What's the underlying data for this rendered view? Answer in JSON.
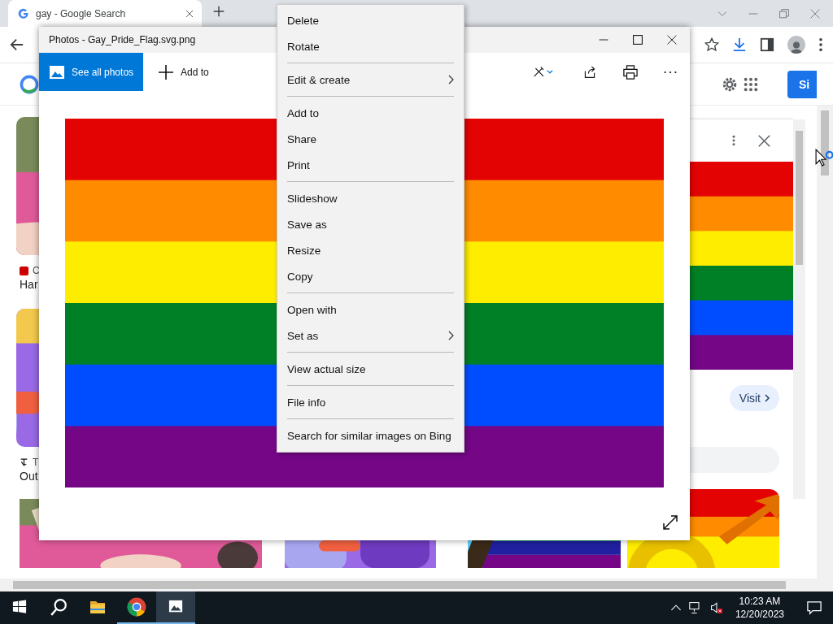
{
  "browser": {
    "tab": {
      "title": "gay - Google Search"
    },
    "page": {
      "sign_in": "Si",
      "results": [
        {
          "source": "C",
          "title": "Har",
          "kind": "cnn"
        },
        {
          "source": "T",
          "title": "Out",
          "kind": "nyt"
        }
      ],
      "side_panel": {
        "visit": "Visit"
      }
    }
  },
  "photos_window": {
    "title": "Photos - Gay_Pride_Flag.svg.png",
    "see_all": "See all photos",
    "add_to": "Add to"
  },
  "context_menu": {
    "groups": [
      [
        {
          "label": "Delete",
          "submenu": false
        },
        {
          "label": "Rotate",
          "submenu": false
        }
      ],
      [
        {
          "label": "Edit & create",
          "submenu": true
        }
      ],
      [
        {
          "label": "Add to",
          "submenu": false
        },
        {
          "label": "Share",
          "submenu": false
        },
        {
          "label": "Print",
          "submenu": false
        }
      ],
      [
        {
          "label": "Slideshow",
          "submenu": false
        },
        {
          "label": "Save as",
          "submenu": false
        },
        {
          "label": "Resize",
          "submenu": false
        },
        {
          "label": "Copy",
          "submenu": false
        }
      ],
      [
        {
          "label": "Open with",
          "submenu": false
        },
        {
          "label": "Set as",
          "submenu": true
        }
      ],
      [
        {
          "label": "View actual size",
          "submenu": false
        }
      ],
      [
        {
          "label": "File info",
          "submenu": false
        }
      ],
      [
        {
          "label": "Search for similar images on Bing",
          "submenu": false
        }
      ]
    ]
  },
  "taskbar": {
    "apps": [
      {
        "kind": "start",
        "running": false,
        "selected": false
      },
      {
        "kind": "search",
        "running": false,
        "selected": false
      },
      {
        "kind": "files",
        "running": false,
        "selected": false
      },
      {
        "kind": "chrome",
        "running": true,
        "selected": false
      },
      {
        "kind": "photos",
        "running": true,
        "selected": true
      }
    ],
    "time": "10:23 AM",
    "date": "12/20/2023"
  }
}
